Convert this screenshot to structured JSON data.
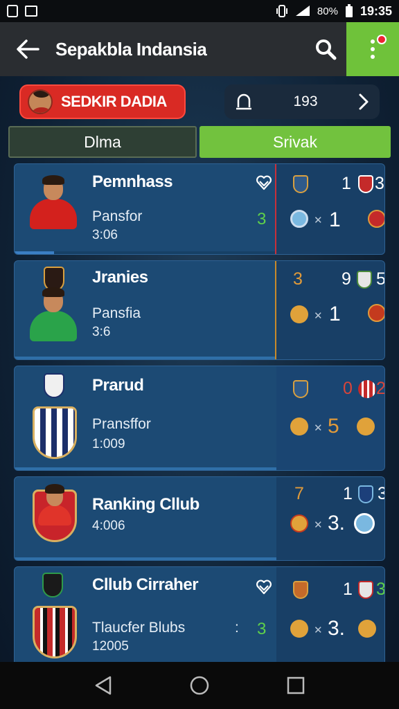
{
  "status_bar": {
    "battery": "80%",
    "time": "19:35"
  },
  "app_bar": {
    "title": "Sepakbla Indansia"
  },
  "header": {
    "profile_name": "SEDKIR DADIA",
    "counter_value": "193"
  },
  "tabs": [
    {
      "label": "Dlma",
      "active": false
    },
    {
      "label": "Srivak",
      "active": true
    }
  ],
  "cards": [
    {
      "title": "Pemnhass",
      "subtitle": "Pansfor",
      "time": "3:06",
      "left_score": "3",
      "has_heart": true,
      "divider_color": "#c9303a",
      "progress": 0.15,
      "row1": {
        "a": "1",
        "b": "3"
      },
      "row2": {
        "a": "1"
      }
    },
    {
      "title": "Jranies",
      "subtitle": "Pansfia",
      "time": "3:6",
      "left_score": "",
      "has_heart": false,
      "divider_color": "#c88a2a",
      "progress": 0.0,
      "row1": {
        "a": "3",
        "b": "9",
        "c": "5"
      },
      "row2": {
        "a": "1"
      }
    },
    {
      "title": "Prarud",
      "subtitle": "Pransffor",
      "time": "1:009",
      "left_score": "",
      "has_heart": false,
      "divider_color": "#1c4a74",
      "progress": 0.0,
      "row1": {
        "a": "0",
        "b": "2"
      },
      "row2": {
        "a": "5"
      }
    },
    {
      "title": "Ranking Cllub",
      "subtitle": "",
      "time": "4:006",
      "left_score": "",
      "has_heart": false,
      "divider_color": "#1c4a74",
      "progress": 0.0,
      "row1": {
        "a": "7",
        "b": "1",
        "c": "3"
      },
      "row2": {
        "a": "3."
      }
    },
    {
      "title": "Cllub Cirraher",
      "subtitle": "Tlaucfer Blubs",
      "time": "12005",
      "left_score": "3",
      "has_heart": true,
      "divider_color": "#1c4a74",
      "progress": 0.0,
      "row1": {
        "a": "1",
        "b": "3"
      },
      "row2": {
        "a": "3."
      }
    }
  ],
  "card_extra": {
    "colon": ":"
  },
  "colors": {
    "accent_green": "#6fc23a",
    "accent_red": "#d92a24",
    "card_bg": "#1c4a74"
  }
}
